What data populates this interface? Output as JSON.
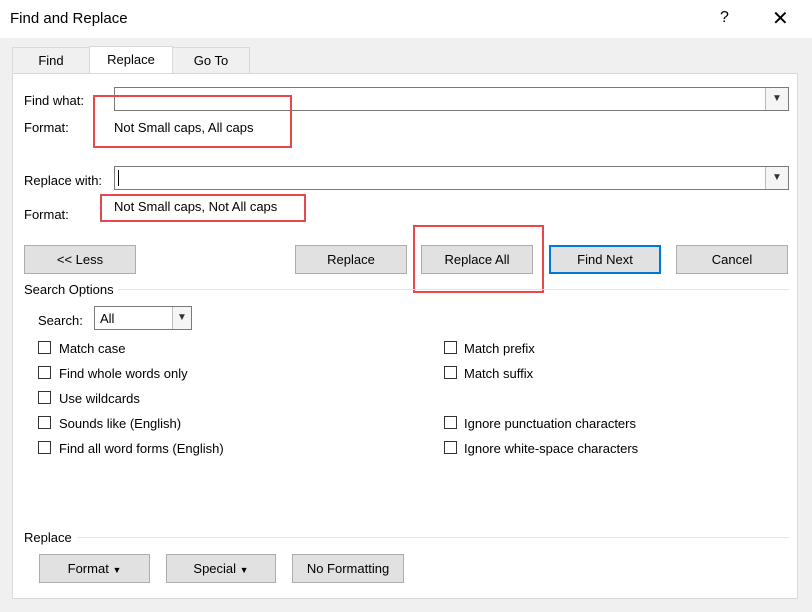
{
  "window": {
    "title": "Find and Replace",
    "help_glyph": "?",
    "close_glyph": "✕"
  },
  "tabs": [
    {
      "label": "Find",
      "active": false
    },
    {
      "label": "Replace",
      "active": true
    },
    {
      "label": "Go To",
      "active": false
    }
  ],
  "find": {
    "label": "Find what:",
    "value": "",
    "format_label": "Format:",
    "format_value": "Not Small caps, All caps"
  },
  "replace": {
    "label": "Replace with:",
    "value": "",
    "format_label": "Format:",
    "format_value": "Not Small caps, Not All caps"
  },
  "buttons": {
    "less": "<< Less",
    "replace": "Replace",
    "replace_all": "Replace All",
    "find_next": "Find Next",
    "cancel": "Cancel"
  },
  "search_options": {
    "heading": "Search Options",
    "search_label": "Search:",
    "search_value": "All",
    "left_checkboxes": [
      {
        "label": "Match case",
        "checked": false
      },
      {
        "label": "Find whole words only",
        "checked": false
      },
      {
        "label": "Use wildcards",
        "checked": false
      },
      {
        "label": "Sounds like (English)",
        "checked": false
      },
      {
        "label": "Find all word forms (English)",
        "checked": false
      }
    ],
    "right_checkboxes": [
      {
        "label": "Match prefix",
        "checked": false
      },
      {
        "label": "Match suffix",
        "checked": false
      },
      {
        "label": "Ignore punctuation characters",
        "checked": false
      },
      {
        "label": "Ignore white-space characters",
        "checked": false
      }
    ]
  },
  "replace_section": {
    "heading": "Replace",
    "format_button": "Format",
    "special_button": "Special",
    "no_formatting_button": "No Formatting"
  },
  "colors": {
    "highlight": "#e8474c",
    "default_button_border": "#0078d7",
    "dialog_bg": "#f0f0f0"
  },
  "icons": {
    "dropdown": "chevron-down-icon",
    "menu_arrow": "dropdown-triangle-icon"
  }
}
